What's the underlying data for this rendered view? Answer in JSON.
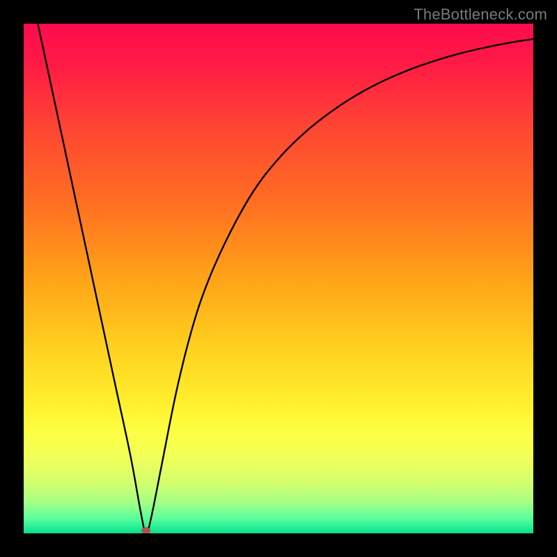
{
  "watermark": "TheBottleneck.com",
  "chart_data": {
    "type": "line",
    "title": "",
    "xlabel": "",
    "ylabel": "",
    "x_range": [
      0,
      100
    ],
    "y_range": [
      0,
      100
    ],
    "minimum_x": 24,
    "series": [
      {
        "name": "curve",
        "x": [
          0,
          3,
          6,
          9,
          12,
          15,
          18,
          21,
          23,
          24,
          25,
          27,
          30,
          33,
          36,
          40,
          45,
          50,
          55,
          60,
          65,
          70,
          75,
          80,
          85,
          90,
          95,
          100
        ],
        "y": [
          113,
          99,
          85,
          71,
          57,
          43,
          29,
          15,
          4,
          0,
          3,
          13,
          28,
          40,
          49,
          58,
          67,
          73.5,
          78.5,
          82.5,
          85.8,
          88.5,
          90.7,
          92.5,
          94,
          95.2,
          96.2,
          97
        ]
      }
    ],
    "marker": {
      "x": 24,
      "y": 0,
      "color": "#b2524a"
    },
    "gradient_stops": [
      {
        "offset": 0.0,
        "color": "#ff0b4e"
      },
      {
        "offset": 0.08,
        "color": "#ff1b45"
      },
      {
        "offset": 0.2,
        "color": "#ff4433"
      },
      {
        "offset": 0.35,
        "color": "#ff6e22"
      },
      {
        "offset": 0.5,
        "color": "#ffa318"
      },
      {
        "offset": 0.63,
        "color": "#ffcf1e"
      },
      {
        "offset": 0.75,
        "color": "#fff12f"
      },
      {
        "offset": 0.8,
        "color": "#fdff42"
      },
      {
        "offset": 0.85,
        "color": "#f1ff58"
      },
      {
        "offset": 0.9,
        "color": "#d4ff6e"
      },
      {
        "offset": 0.94,
        "color": "#a3ff85"
      },
      {
        "offset": 0.97,
        "color": "#5cff9e"
      },
      {
        "offset": 1.0,
        "color": "#04e28c"
      }
    ]
  }
}
